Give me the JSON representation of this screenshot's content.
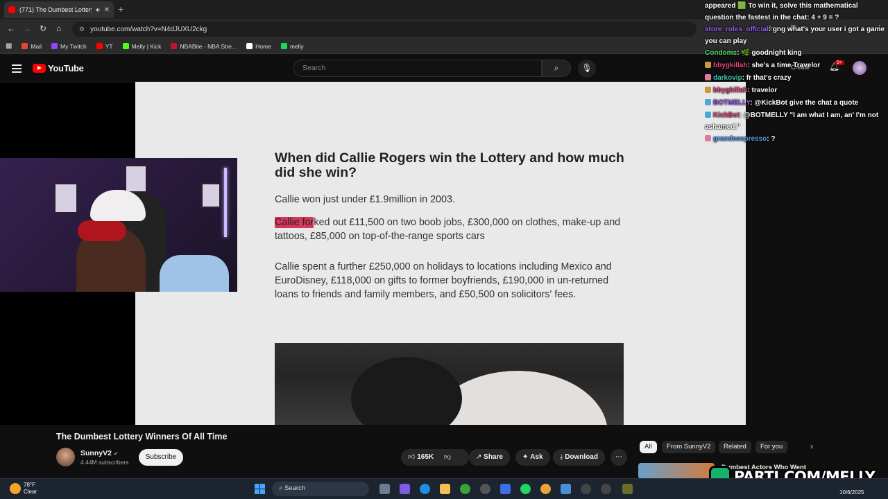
{
  "browser": {
    "tab_title": "(771) The Dumbest Lottery",
    "tab_audio_icon": "speaker-icon",
    "url": "youtube.com/watch?v=N4dJUXU2ckg",
    "bookmarks": [
      {
        "label": "Mail",
        "color": "#ea4335"
      },
      {
        "label": "My Twitch",
        "color": "#9146ff"
      },
      {
        "label": "YT",
        "color": "#ff0000"
      },
      {
        "label": "Melly | Kick",
        "color": "#53fc18"
      },
      {
        "label": "NBABite - NBA Stre...",
        "color": "#c8102e"
      },
      {
        "label": "Home",
        "color": "#ffffff"
      },
      {
        "label": "melly",
        "color": "#1ed760"
      }
    ]
  },
  "youtube": {
    "logo_text": "YouTube",
    "search_placeholder": "Search",
    "create_label": "Create",
    "notifications_badge": "9+"
  },
  "article": {
    "heading": "When did Callie Rogers win the Lottery and how much did she win?",
    "p1": "Callie won just under £1.9million in 2003.",
    "p2_highlight": "Callie for",
    "p2_rest": "ked out £11,500 on two boob jobs, £300,000 on clothes, make-up and tattoos, £85,000 on top-of-the-range sports cars",
    "p3": "Callie spent a further £250,000 on holidays to locations including Mexico and EuroDisney, £118,000 on gifts to former boyfriends, £190,000 in un-returned loans to friends and family members, and £50,500 on solicitors' fees."
  },
  "chat": [
    {
      "user": "",
      "text": "appeared 🟩 To win it, solve this mathematical question the fastest in the chat: 4 + 9 = ?",
      "user_color": "#ffffff"
    },
    {
      "user": "store_roles_official",
      "text": ": gng what's your user i got a game you can play",
      "user_color": "#9b5cf2"
    },
    {
      "user": "Condoms",
      "text": ": 🌿 goodnight king",
      "user_color": "#53d86a"
    },
    {
      "user": "bbygkillah",
      "text": ": she's a time Travelor",
      "user_color": "#e0487a"
    },
    {
      "user": "darkovip",
      "text": ": fr that's crazy",
      "user_color": "#3fc6b0"
    },
    {
      "user": "bbygkillah",
      "text": ": travelor",
      "user_color": "#e0487a"
    },
    {
      "user": "BOTMELLY",
      "text": ": @KickBot give the chat a quote",
      "user_color": "#9b5cf2"
    },
    {
      "user": "KickBot",
      "text": ": @BOTMELLY \"I am what I am, an' I'm not ashamed.\"",
      "user_color": "#e0487a"
    },
    {
      "user": "grandeespresso",
      "text": ": ?",
      "user_color": "#5a9cf0"
    }
  ],
  "video_info": {
    "title": "The Dumbest Lottery Winners Of All Time",
    "channel": "SunnyV2",
    "verified": "✔",
    "subscribers": "4.44M subscribers",
    "subscribe_label": "Subscribe",
    "likes": "165K",
    "share_label": "Share",
    "ask_label": "Ask",
    "download_label": "Download",
    "chips": [
      "All",
      "From SunnyV2",
      "Related",
      "For you"
    ],
    "rec_title": "Dumbest Actors Who Went"
  },
  "overlay": {
    "watermark": "PARTI.COM/MELLY"
  },
  "taskbar": {
    "temperature": "78°F",
    "condition": "Clear",
    "search_label": "Search",
    "date": "10/6/2025"
  }
}
